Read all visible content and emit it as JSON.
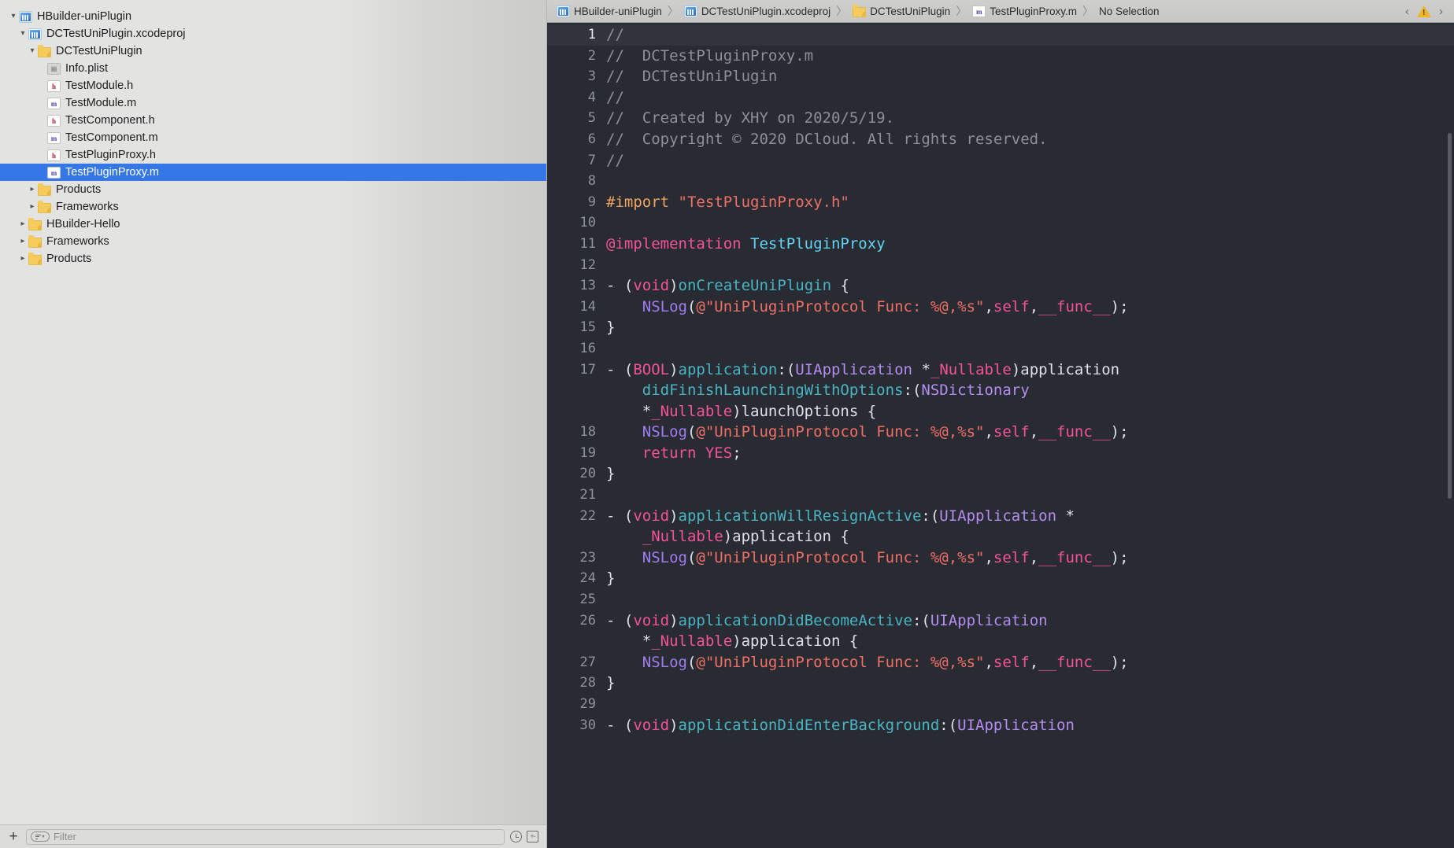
{
  "navigator": {
    "tree": [
      {
        "depth": 0,
        "disc": "open",
        "icon": "project-icon",
        "label": "HBuilder-uniPlugin",
        "selected": false
      },
      {
        "depth": 1,
        "disc": "open",
        "icon": "xcodeproj-icon",
        "label": "DCTestUniPlugin.xcodeproj",
        "selected": false
      },
      {
        "depth": 2,
        "disc": "open",
        "icon": "folder-icon",
        "label": "DCTestUniPlugin",
        "selected": false
      },
      {
        "depth": 3,
        "disc": "none",
        "icon": "plist-icon",
        "label": "Info.plist",
        "selected": false
      },
      {
        "depth": 3,
        "disc": "none",
        "icon": "header-icon",
        "label": "TestModule.h",
        "selected": false
      },
      {
        "depth": 3,
        "disc": "none",
        "icon": "source-icon",
        "label": "TestModule.m",
        "selected": false
      },
      {
        "depth": 3,
        "disc": "none",
        "icon": "header-icon",
        "label": "TestComponent.h",
        "selected": false
      },
      {
        "depth": 3,
        "disc": "none",
        "icon": "source-icon",
        "label": "TestComponent.m",
        "selected": false
      },
      {
        "depth": 3,
        "disc": "none",
        "icon": "header-icon",
        "label": "TestPluginProxy.h",
        "selected": false
      },
      {
        "depth": 3,
        "disc": "none",
        "icon": "source-icon",
        "label": "TestPluginProxy.m",
        "selected": true
      },
      {
        "depth": 2,
        "disc": "closed",
        "icon": "folder-icon",
        "label": "Products",
        "selected": false
      },
      {
        "depth": 2,
        "disc": "closed",
        "icon": "folder-icon",
        "label": "Frameworks",
        "selected": false
      },
      {
        "depth": 1,
        "disc": "closed",
        "icon": "folder-icon",
        "label": "HBuilder-Hello",
        "selected": false
      },
      {
        "depth": 1,
        "disc": "closed",
        "icon": "folder-icon",
        "label": "Frameworks",
        "selected": false
      },
      {
        "depth": 1,
        "disc": "closed",
        "icon": "folder-icon",
        "label": "Products",
        "selected": false
      }
    ],
    "bottom_bar": {
      "add_label": "+",
      "filter_placeholder": "Filter",
      "filter_value": "",
      "clock_icon": "clock-icon",
      "plusminus_icon": "plus-minus-icon"
    }
  },
  "jumpbar": {
    "crumbs": [
      {
        "icon": "project-icon",
        "label": "HBuilder-uniPlugin"
      },
      {
        "icon": "xcodeproj-icon",
        "label": "DCTestUniPlugin.xcodeproj"
      },
      {
        "icon": "folder-icon",
        "label": "DCTestUniPlugin"
      },
      {
        "icon": "source-icon",
        "label": "TestPluginProxy.m"
      },
      {
        "icon": "none",
        "label": "No Selection"
      }
    ],
    "separator": "〉",
    "back_icon": "chevron-left-icon",
    "warning_icon": "warning-triangle-icon",
    "forward_icon": "chevron-right-icon"
  },
  "editor": {
    "filename": "TestPluginProxy.m",
    "current_line": 1,
    "colors": {
      "background": "#292b33",
      "current_line": "#32343c",
      "comment": "#8d9099",
      "preprocessor": "#f0a35e",
      "string": "#f06f66",
      "keyword": "#f5529a",
      "type": "#b58cf0",
      "method": "#49b5c4",
      "classname": "#63d3f5",
      "plain": "#dfe1e8",
      "gutter": "#8f939c",
      "selection_blue": "#3577e7"
    },
    "lines": [
      {
        "n": 1,
        "tokens": [
          {
            "t": "//",
            "c": "comment"
          }
        ]
      },
      {
        "n": 2,
        "tokens": [
          {
            "t": "//  DCTestPluginProxy.m",
            "c": "comment"
          }
        ]
      },
      {
        "n": 3,
        "tokens": [
          {
            "t": "//  DCTestUniPlugin",
            "c": "comment"
          }
        ]
      },
      {
        "n": 4,
        "tokens": [
          {
            "t": "//",
            "c": "comment"
          }
        ]
      },
      {
        "n": 5,
        "tokens": [
          {
            "t": "//  Created by XHY on 2020/5/19.",
            "c": "comment"
          }
        ]
      },
      {
        "n": 6,
        "tokens": [
          {
            "t": "//  Copyright © 2020 DCloud. All rights reserved.",
            "c": "comment"
          }
        ]
      },
      {
        "n": 7,
        "tokens": [
          {
            "t": "//",
            "c": "comment"
          }
        ]
      },
      {
        "n": 8,
        "tokens": []
      },
      {
        "n": 9,
        "tokens": [
          {
            "t": "#import ",
            "c": "pre"
          },
          {
            "t": "\"TestPluginProxy.h\"",
            "c": "str"
          }
        ]
      },
      {
        "n": 10,
        "tokens": []
      },
      {
        "n": 11,
        "tokens": [
          {
            "t": "@implementation ",
            "c": "kw"
          },
          {
            "t": "TestPluginProxy",
            "c": "class"
          }
        ]
      },
      {
        "n": 12,
        "tokens": []
      },
      {
        "n": 13,
        "tokens": [
          {
            "t": "- (",
            "c": "plain"
          },
          {
            "t": "void",
            "c": "kw"
          },
          {
            "t": ")",
            "c": "plain"
          },
          {
            "t": "onCreateUniPlugin",
            "c": "meth"
          },
          {
            "t": " {",
            "c": "plain"
          }
        ]
      },
      {
        "n": 14,
        "tokens": [
          {
            "t": "    ",
            "c": "plain"
          },
          {
            "t": "NSLog",
            "c": "func"
          },
          {
            "t": "(",
            "c": "plain"
          },
          {
            "t": "@\"UniPluginProtocol Func: %@,%s\"",
            "c": "str"
          },
          {
            "t": ",",
            "c": "plain"
          },
          {
            "t": "self",
            "c": "kw"
          },
          {
            "t": ",",
            "c": "plain"
          },
          {
            "t": "__func__",
            "c": "kw"
          },
          {
            "t": ");",
            "c": "plain"
          }
        ]
      },
      {
        "n": 15,
        "tokens": [
          {
            "t": "}",
            "c": "plain"
          }
        ]
      },
      {
        "n": 16,
        "tokens": []
      },
      {
        "n": 17,
        "tokens": [
          {
            "t": "- (",
            "c": "plain"
          },
          {
            "t": "BOOL",
            "c": "kw"
          },
          {
            "t": ")",
            "c": "plain"
          },
          {
            "t": "application",
            "c": "meth"
          },
          {
            "t": ":(",
            "c": "plain"
          },
          {
            "t": "UIApplication",
            "c": "type"
          },
          {
            "t": " *",
            "c": "plain"
          },
          {
            "t": "_Nullable",
            "c": "kw"
          },
          {
            "t": ")application",
            "c": "plain"
          }
        ],
        "wrap": [
          [
            {
              "t": "    ",
              "c": "plain"
            },
            {
              "t": "didFinishLaunchingWithOptions",
              "c": "meth"
            },
            {
              "t": ":(",
              "c": "plain"
            },
            {
              "t": "NSDictionary",
              "c": "type"
            }
          ],
          [
            {
              "t": "    *",
              "c": "plain"
            },
            {
              "t": "_Nullable",
              "c": "kw"
            },
            {
              "t": ")launchOptions {",
              "c": "plain"
            }
          ]
        ]
      },
      {
        "n": 18,
        "tokens": [
          {
            "t": "    ",
            "c": "plain"
          },
          {
            "t": "NSLog",
            "c": "func"
          },
          {
            "t": "(",
            "c": "plain"
          },
          {
            "t": "@\"UniPluginProtocol Func: %@,%s\"",
            "c": "str"
          },
          {
            "t": ",",
            "c": "plain"
          },
          {
            "t": "self",
            "c": "kw"
          },
          {
            "t": ",",
            "c": "plain"
          },
          {
            "t": "__func__",
            "c": "kw"
          },
          {
            "t": ");",
            "c": "plain"
          }
        ]
      },
      {
        "n": 19,
        "tokens": [
          {
            "t": "    ",
            "c": "plain"
          },
          {
            "t": "return",
            "c": "kw"
          },
          {
            "t": " ",
            "c": "plain"
          },
          {
            "t": "YES",
            "c": "kw"
          },
          {
            "t": ";",
            "c": "plain"
          }
        ]
      },
      {
        "n": 20,
        "tokens": [
          {
            "t": "}",
            "c": "plain"
          }
        ]
      },
      {
        "n": 21,
        "tokens": []
      },
      {
        "n": 22,
        "tokens": [
          {
            "t": "- (",
            "c": "plain"
          },
          {
            "t": "void",
            "c": "kw"
          },
          {
            "t": ")",
            "c": "plain"
          },
          {
            "t": "applicationWillResignActive",
            "c": "meth"
          },
          {
            "t": ":(",
            "c": "plain"
          },
          {
            "t": "UIApplication",
            "c": "type"
          },
          {
            "t": " *",
            "c": "plain"
          }
        ],
        "wrap": [
          [
            {
              "t": "    ",
              "c": "plain"
            },
            {
              "t": "_Nullable",
              "c": "kw"
            },
            {
              "t": ")application {",
              "c": "plain"
            }
          ]
        ]
      },
      {
        "n": 23,
        "tokens": [
          {
            "t": "    ",
            "c": "plain"
          },
          {
            "t": "NSLog",
            "c": "func"
          },
          {
            "t": "(",
            "c": "plain"
          },
          {
            "t": "@\"UniPluginProtocol Func: %@,%s\"",
            "c": "str"
          },
          {
            "t": ",",
            "c": "plain"
          },
          {
            "t": "self",
            "c": "kw"
          },
          {
            "t": ",",
            "c": "plain"
          },
          {
            "t": "__func__",
            "c": "kw"
          },
          {
            "t": ");",
            "c": "plain"
          }
        ]
      },
      {
        "n": 24,
        "tokens": [
          {
            "t": "}",
            "c": "plain"
          }
        ]
      },
      {
        "n": 25,
        "tokens": []
      },
      {
        "n": 26,
        "tokens": [
          {
            "t": "- (",
            "c": "plain"
          },
          {
            "t": "void",
            "c": "kw"
          },
          {
            "t": ")",
            "c": "plain"
          },
          {
            "t": "applicationDidBecomeActive",
            "c": "meth"
          },
          {
            "t": ":(",
            "c": "plain"
          },
          {
            "t": "UIApplication",
            "c": "type"
          }
        ],
        "wrap": [
          [
            {
              "t": "    *",
              "c": "plain"
            },
            {
              "t": "_Nullable",
              "c": "kw"
            },
            {
              "t": ")application {",
              "c": "plain"
            }
          ]
        ]
      },
      {
        "n": 27,
        "tokens": [
          {
            "t": "    ",
            "c": "plain"
          },
          {
            "t": "NSLog",
            "c": "func"
          },
          {
            "t": "(",
            "c": "plain"
          },
          {
            "t": "@\"UniPluginProtocol Func: %@,%s\"",
            "c": "str"
          },
          {
            "t": ",",
            "c": "plain"
          },
          {
            "t": "self",
            "c": "kw"
          },
          {
            "t": ",",
            "c": "plain"
          },
          {
            "t": "__func__",
            "c": "kw"
          },
          {
            "t": ");",
            "c": "plain"
          }
        ]
      },
      {
        "n": 28,
        "tokens": [
          {
            "t": "}",
            "c": "plain"
          }
        ]
      },
      {
        "n": 29,
        "tokens": []
      },
      {
        "n": 30,
        "tokens": [
          {
            "t": "- (",
            "c": "plain"
          },
          {
            "t": "void",
            "c": "kw"
          },
          {
            "t": ")",
            "c": "plain"
          },
          {
            "t": "applicationDidEnterBackground",
            "c": "meth"
          },
          {
            "t": ":(",
            "c": "plain"
          },
          {
            "t": "UIApplication",
            "c": "type"
          }
        ]
      }
    ]
  }
}
